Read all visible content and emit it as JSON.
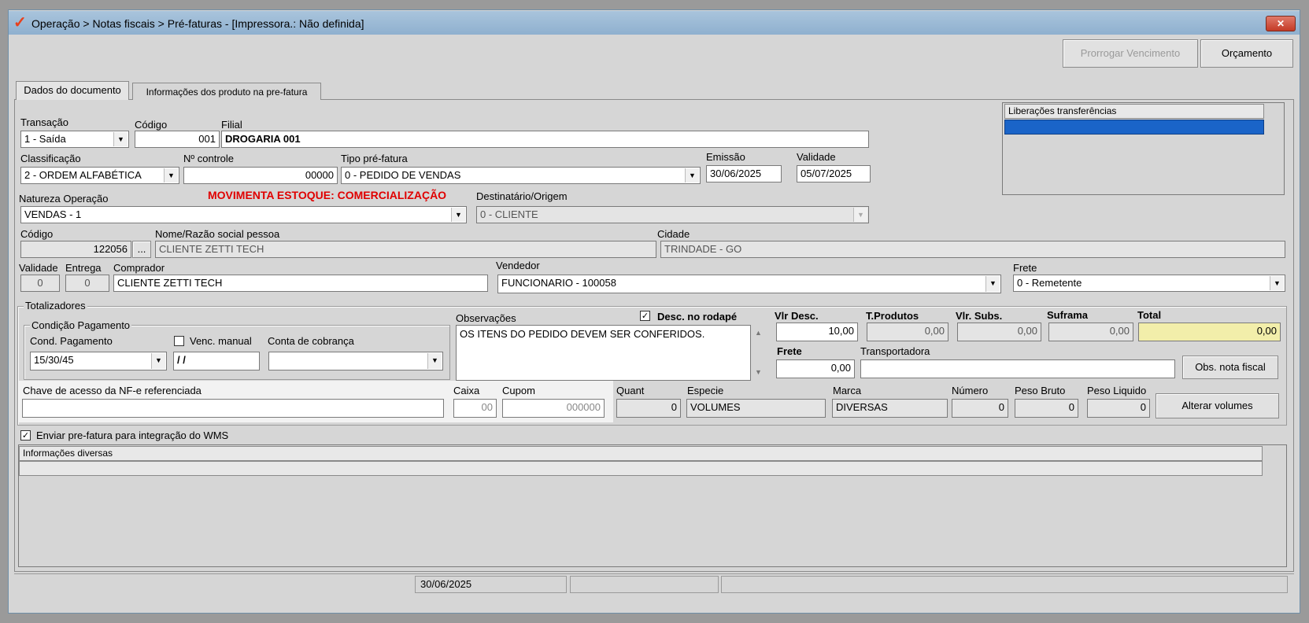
{
  "window": {
    "title": "Operação > Notas fiscais > Pré-faturas - [Impressora.: Não definida]",
    "logo": "✓",
    "close": "✕"
  },
  "toolbar": {
    "prorrogar": "Prorrogar Vencimento",
    "orcamento": "Orçamento"
  },
  "tabs": [
    {
      "label": "Dados do documento"
    },
    {
      "label": "Informações dos produto na pre-fatura"
    }
  ],
  "doc": {
    "transacao_label": "Transação",
    "transacao_value": "1 - Saída",
    "codigo_label": "Código",
    "codigo_value": "001",
    "filial_label": "Filial",
    "filial_value": "DROGARIA 001",
    "classificacao_label": "Classificação",
    "classificacao_value": "2 - ORDEM ALFABÉTICA",
    "ncontrole_label": "Nº controle",
    "ncontrole_value": "00000",
    "tipo_label": "Tipo pré-fatura",
    "tipo_value": "0 - PEDIDO DE VENDAS",
    "emissao_label": "Emissão",
    "emissao_value": "30/06/2025",
    "validade_label": "Validade",
    "validade_value": "05/07/2025",
    "natureza_label": "Natureza  Operação",
    "natureza_value": "VENDAS - 1",
    "movimenta": "MOVIMENTA ESTOQUE: COMERCIALIZAÇÃO",
    "destinatario_label": "Destinatário/Origem",
    "destinatario_value": "0 - CLIENTE",
    "codpessoa_label": "Código",
    "codpessoa_value": "122056",
    "ellipsis": "...",
    "nome_label": "Nome/Razão social pessoa",
    "nome_value": "CLIENTE ZETTI TECH",
    "cidade_label": "Cidade",
    "cidade_value": "TRINDADE - GO",
    "validade2_label": "Validade",
    "validade2_value": "0",
    "entrega_label": "Entrega",
    "entrega_value": "0",
    "comprador_label": "Comprador",
    "comprador_value": "CLIENTE ZETTI TECH",
    "vendedor_label": "Vendedor",
    "vendedor_value": "FUNCIONARIO - 100058",
    "frete_label": "Frete",
    "frete_value": "0 - Remetente"
  },
  "liberacoes": {
    "header": "Liberações transferências"
  },
  "totalizadores": {
    "title": "Totalizadores",
    "condicao_title": "Condição Pagamento",
    "cond_label": "Cond. Pagamento",
    "cond_value": "15/30/45",
    "venc_label": "Venc. manual",
    "venc_value": "/ /",
    "conta_label": "Conta de cobrança",
    "conta_value": "",
    "obs_label": "Observações",
    "obs_value": "OS ITENS DO PEDIDO DEVEM SER CONFERIDOS.",
    "desc_rodape": "Desc. no rodapé",
    "check": "✓",
    "vlrdesc_label": "Vlr Desc.",
    "vlrdesc_value": "10,00",
    "tprod_label": "T.Produtos",
    "tprod_value": "0,00",
    "vlrsubs_label": "Vlr. Subs.",
    "vlrsubs_value": "0,00",
    "suframa_label": "Suframa",
    "suframa_value": "0,00",
    "total_label": "Total",
    "total_value": "0,00",
    "frete_label": "Frete",
    "frete_value": "0,00",
    "transp_label": "Transportadora",
    "transp_value": "",
    "obsnota_btn": "Obs. nota fiscal",
    "chave_label": "Chave de acesso da NF-e referenciada",
    "chave_value": "",
    "caixa_label": "Caixa",
    "caixa_value": "00",
    "cupom_label": "Cupom",
    "cupom_value": "000000",
    "quant_label": "Quant",
    "quant_value": "0",
    "especie_label": "Especie",
    "especie_value": "VOLUMES",
    "marca_label": "Marca",
    "marca_value": "DIVERSAS",
    "numero_label": "Número",
    "numero_value": "0",
    "pesobruto_label": "Peso Bruto",
    "pesobruto_value": "0",
    "pesoliq_label": "Peso Liquido",
    "pesoliq_value": "0",
    "alterar_btn": "Alterar volumes",
    "up_arrow": "▲",
    "down_arrow": "▼"
  },
  "wms": {
    "label": "Enviar pre-fatura para integração do WMS"
  },
  "info": {
    "header": "Informações diversas"
  },
  "status": {
    "date": "30/06/2025"
  },
  "dropdown_arrow": "▼"
}
